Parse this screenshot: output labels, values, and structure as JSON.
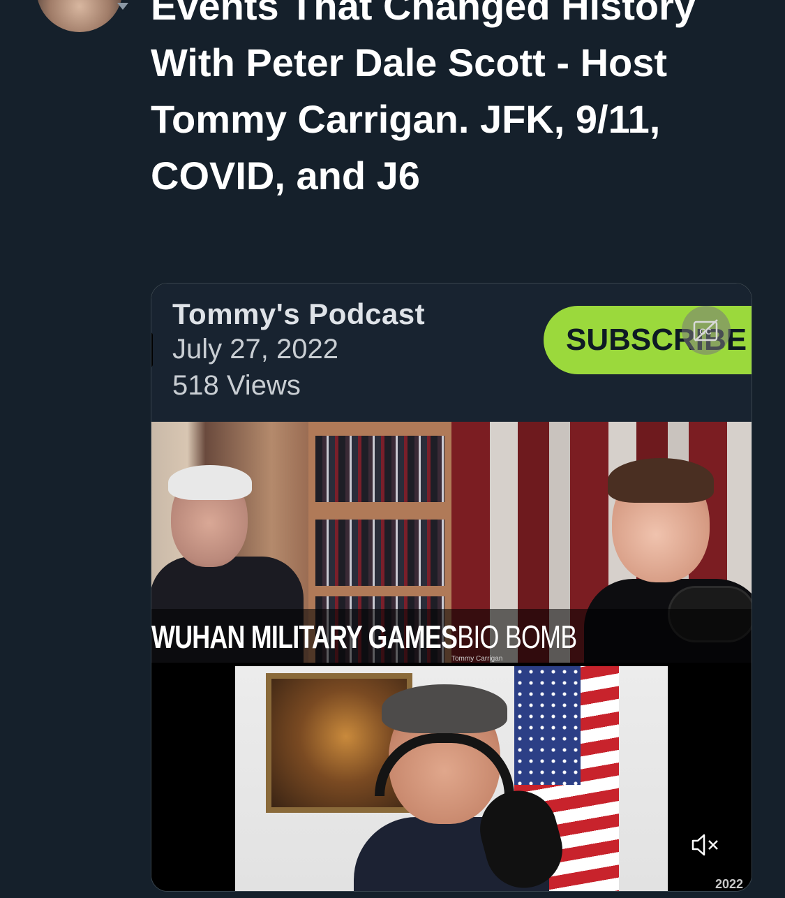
{
  "tweet": {
    "title": "Events That Changed History With Peter Dale Scott - Host Tommy Carrigan. JFK, 9/11, COVID, and J6"
  },
  "video_card": {
    "podcast_name": "Tommy's Podcast",
    "date": "July 27, 2022",
    "views": "518 Views",
    "subscribe_label": "SUBSCRIBE",
    "cc_icon": "closed-captions-icon",
    "lower_third": {
      "bold_text": "WUHAN MILITARY GAMES",
      "light_text": "BIO BOMB",
      "small_caption": "Tommy Carrigan"
    },
    "mute_icon": "speaker-muted-icon",
    "corner_text": "2022"
  },
  "colors": {
    "background": "#15202b",
    "subscribe_green": "#9bd93c"
  }
}
